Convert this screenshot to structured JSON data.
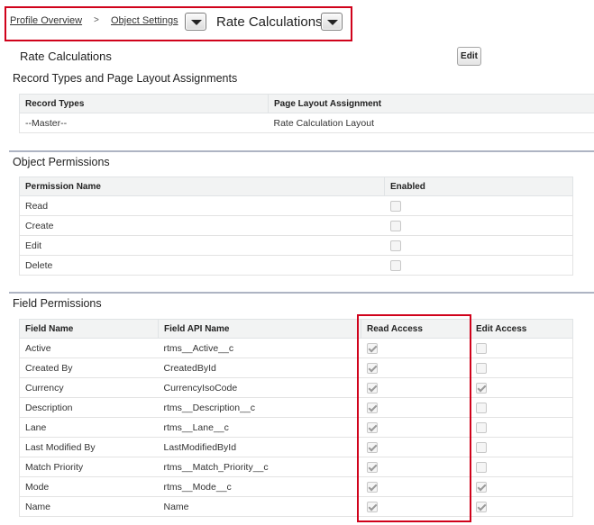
{
  "breadcrumb": {
    "profile_overview": "Profile Overview",
    "separator": ">",
    "object_settings": "Object Settings",
    "current": "Rate Calculations"
  },
  "header": {
    "title": "Rate Calculations",
    "edit_label": "Edit"
  },
  "record_types": {
    "title": "Record Types and Page Layout Assignments",
    "columns": [
      "Record Types",
      "Page Layout Assignment"
    ],
    "rows": [
      [
        "--Master--",
        "Rate Calculation Layout"
      ]
    ]
  },
  "object_permissions": {
    "title": "Object Permissions",
    "columns": [
      "Permission Name",
      "Enabled"
    ],
    "rows": [
      {
        "name": "Read",
        "enabled": false
      },
      {
        "name": "Create",
        "enabled": false
      },
      {
        "name": "Edit",
        "enabled": false
      },
      {
        "name": "Delete",
        "enabled": false
      }
    ]
  },
  "field_permissions": {
    "title": "Field Permissions",
    "columns": [
      "Field Name",
      "Field API Name",
      "Read Access",
      "Edit Access"
    ],
    "rows": [
      {
        "name": "Active",
        "api": "rtms__Active__c",
        "read": true,
        "edit": false
      },
      {
        "name": "Created By",
        "api": "CreatedById",
        "read": true,
        "edit": false
      },
      {
        "name": "Currency",
        "api": "CurrencyIsoCode",
        "read": true,
        "edit": true
      },
      {
        "name": "Description",
        "api": "rtms__Description__c",
        "read": true,
        "edit": false
      },
      {
        "name": "Lane",
        "api": "rtms__Lane__c",
        "read": true,
        "edit": false
      },
      {
        "name": "Last Modified By",
        "api": "LastModifiedById",
        "read": true,
        "edit": false
      },
      {
        "name": "Match Priority",
        "api": "rtms__Match_Priority__c",
        "read": true,
        "edit": false
      },
      {
        "name": "Mode",
        "api": "rtms__Mode__c",
        "read": true,
        "edit": true
      },
      {
        "name": "Name",
        "api": "Name",
        "read": true,
        "edit": true
      }
    ]
  },
  "colors": {
    "highlight_border": "#d0021b",
    "section_rule": "#aeb4c3",
    "header_bg": "#f2f3f3"
  }
}
